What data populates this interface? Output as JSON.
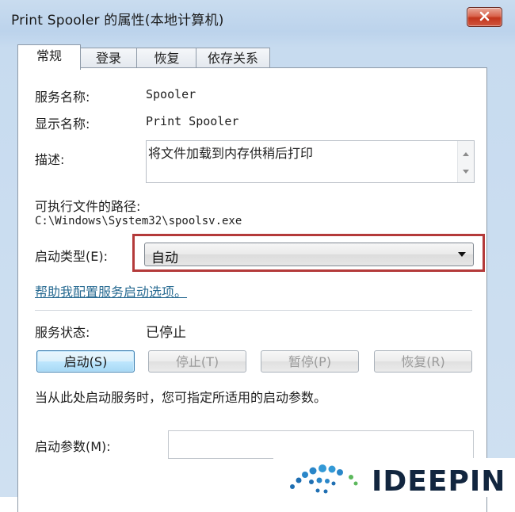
{
  "window": {
    "title": "Print Spooler 的属性(本地计算机)"
  },
  "tabs": [
    {
      "label": "常规",
      "active": true
    },
    {
      "label": "登录",
      "active": false
    },
    {
      "label": "恢复",
      "active": false
    },
    {
      "label": "依存关系",
      "active": false
    }
  ],
  "general": {
    "service_name_label": "服务名称:",
    "service_name": "Spooler",
    "display_name_label": "显示名称:",
    "display_name": "Print Spooler",
    "description_label": "描述:",
    "description": "将文件加载到内存供稍后打印",
    "path_label": "可执行文件的路径:",
    "path": "C:\\Windows\\System32\\spoolsv.exe",
    "startup_type_label": "启动类型(E):",
    "startup_type_value": "自动",
    "help_link": "帮助我配置服务启动选项。",
    "status_label": "服务状态:",
    "status_value": "已停止",
    "buttons": {
      "start": "启动(S)",
      "stop": "停止(T)",
      "pause": "暂停(P)",
      "resume": "恢复(R)"
    },
    "hint": "当从此处启动服务时，您可指定所适用的启动参数。",
    "params_label": "启动参数(M):",
    "params_value": ""
  },
  "watermark": {
    "text": "IDEEPIN"
  },
  "colors": {
    "highlight": "#b43a3a",
    "link": "#2a6c93",
    "primary_button": "#3c7fb1",
    "close_button": "#c2351c"
  },
  "icons": {
    "close": "close-icon",
    "scroll_up": "arrow-up-icon",
    "scroll_down": "arrow-down-icon",
    "dropdown": "dropdown-arrow-icon",
    "logo": "logo-icon"
  }
}
